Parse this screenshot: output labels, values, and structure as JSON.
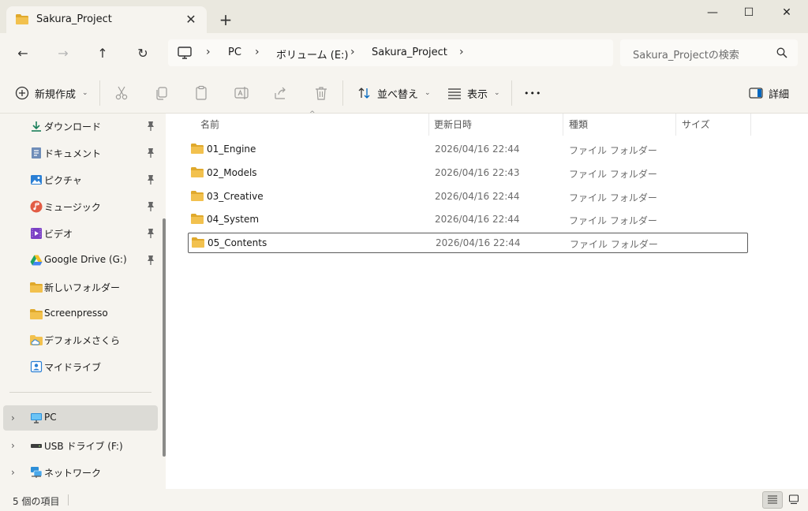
{
  "window": {
    "tab_title": "Sakura_Project",
    "tab_close": "✕",
    "new_tab": "+",
    "minimize": "—",
    "maximize": "☐",
    "close": "✕"
  },
  "nav": {
    "back": "←",
    "forward": "→",
    "up": "↑",
    "refresh": "↻"
  },
  "breadcrumb": {
    "items": [
      "PC",
      "ボリューム (E:)",
      "Sakura_Project"
    ],
    "separator": "›"
  },
  "search": {
    "placeholder": "Sakura_Projectの検索"
  },
  "toolbar": {
    "new_label": "新規作成",
    "sort_label": "並べ替え",
    "view_label": "表示",
    "more_label": "•••",
    "details_label": "詳細",
    "chevron": "⌄"
  },
  "sidebar": {
    "items": [
      {
        "label": "ダウンロード",
        "icon": "download-icon",
        "pinned": true
      },
      {
        "label": "ドキュメント",
        "icon": "document-icon",
        "pinned": true
      },
      {
        "label": "ピクチャ",
        "icon": "pictures-icon",
        "pinned": true
      },
      {
        "label": "ミュージック",
        "icon": "music-icon",
        "pinned": true
      },
      {
        "label": "ビデオ",
        "icon": "video-icon",
        "pinned": true
      },
      {
        "label": "Google Drive (G:)",
        "icon": "google-drive-icon",
        "pinned": true
      },
      {
        "label": "新しいフォルダー",
        "icon": "folder-icon",
        "pinned": false
      },
      {
        "label": "Screenpresso",
        "icon": "folder-icon",
        "pinned": false
      },
      {
        "label": "デフォルメさくら",
        "icon": "cloud-folder-icon",
        "pinned": false
      },
      {
        "label": "マイドライブ",
        "icon": "my-drive-icon",
        "pinned": false
      }
    ],
    "tree": [
      {
        "label": "PC",
        "icon": "pc-icon",
        "selected": true
      },
      {
        "label": "USB ドライブ (F:)",
        "icon": "usb-drive-icon",
        "selected": false
      },
      {
        "label": "ネットワーク",
        "icon": "network-icon",
        "selected": false
      }
    ],
    "expand_glyph": "›"
  },
  "columns": {
    "name": "名前",
    "date": "更新日時",
    "type": "種類",
    "size": "サイズ",
    "sort_indicator": "^"
  },
  "files": [
    {
      "name": "01_Engine",
      "date": "2026/04/16 22:44",
      "type": "ファイル フォルダー"
    },
    {
      "name": "02_Models",
      "date": "2026/04/16 22:43",
      "type": "ファイル フォルダー"
    },
    {
      "name": "03_Creative",
      "date": "2026/04/16 22:44",
      "type": "ファイル フォルダー"
    },
    {
      "name": "04_System",
      "date": "2026/04/16 22:44",
      "type": "ファイル フォルダー"
    },
    {
      "name": "05_Contents",
      "date": "2026/04/16 22:44",
      "type": "ファイル フォルダー"
    }
  ],
  "status": {
    "item_count": "5 個の項目"
  },
  "colors": {
    "folder": "#f2c14e",
    "folder_dark": "#e0a92c",
    "accent": "#0067c0",
    "chrome": "#f6f4ef",
    "titlebar": "#eae8df"
  }
}
